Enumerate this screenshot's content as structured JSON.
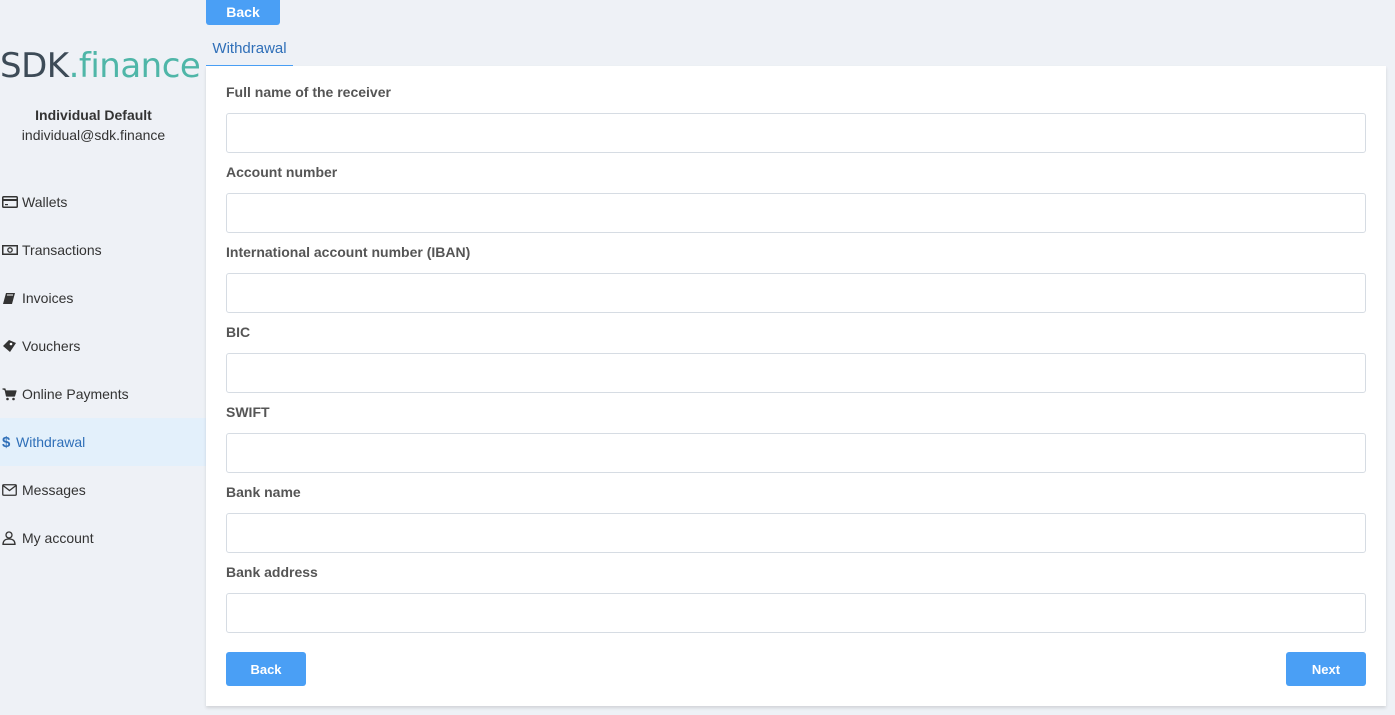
{
  "brand": {
    "part1": "SDK",
    "part2": ".finance"
  },
  "user": {
    "name": "Individual Default",
    "email": "individual@sdk.finance"
  },
  "sidebar": {
    "items": [
      {
        "label": "Wallets",
        "icon": "credit-card-icon",
        "active": false
      },
      {
        "label": "Transactions",
        "icon": "money-icon",
        "active": false
      },
      {
        "label": "Invoices",
        "icon": "book-icon",
        "active": false
      },
      {
        "label": "Vouchers",
        "icon": "ticket-icon",
        "active": false
      },
      {
        "label": "Online Payments",
        "icon": "cart-icon",
        "active": false
      },
      {
        "label": "Withdrawal",
        "icon": "dollar-icon",
        "active": true
      },
      {
        "label": "Messages",
        "icon": "envelope-icon",
        "active": false
      },
      {
        "label": "My account",
        "icon": "user-icon",
        "active": false
      }
    ]
  },
  "header": {
    "back_label": "Back",
    "tab_label": "Withdrawal"
  },
  "form": {
    "fields": [
      {
        "label": "Full name of the receiver",
        "value": "",
        "placeholder": ""
      },
      {
        "label": "Account number",
        "value": "",
        "placeholder": ""
      },
      {
        "label": "International account number (IBAN)",
        "value": "",
        "placeholder": ""
      },
      {
        "label": "BIC",
        "value": "",
        "placeholder": ""
      },
      {
        "label": "SWIFT",
        "value": "",
        "placeholder": ""
      },
      {
        "label": "Bank name",
        "value": "",
        "placeholder": ""
      },
      {
        "label": "Bank address",
        "value": "",
        "placeholder": ""
      }
    ],
    "back_label": "Back",
    "next_label": "Next"
  },
  "colors": {
    "accent": "#4a9ff5",
    "active_text": "#2f6fb8",
    "active_bg": "#e3f0fb",
    "page_bg": "#eef1f6",
    "brand_dark": "#3d4b57",
    "brand_teal": "#4fb6a8"
  }
}
